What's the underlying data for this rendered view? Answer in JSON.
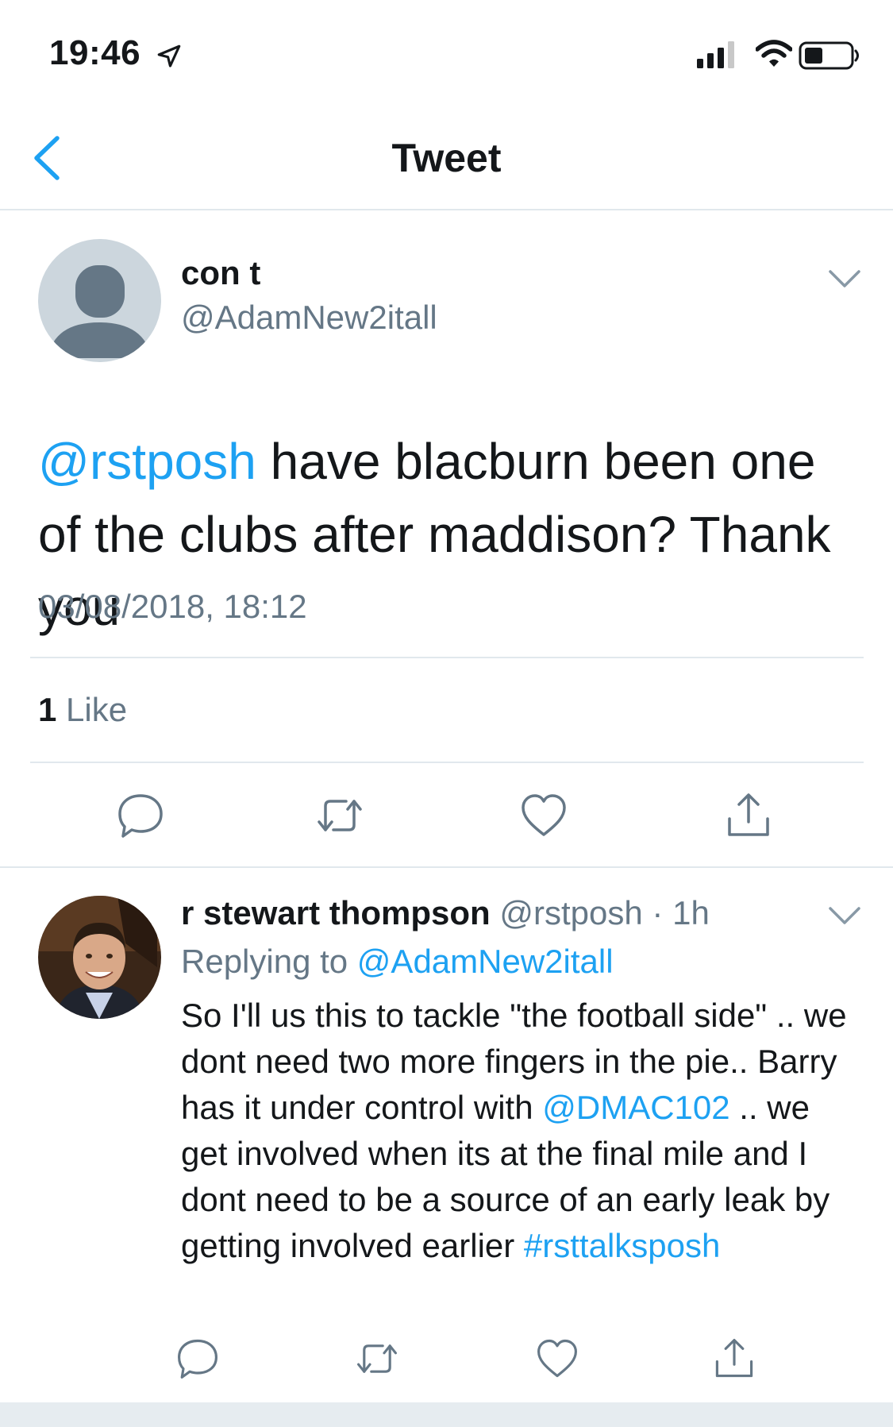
{
  "status_bar": {
    "time": "19:46",
    "icons": [
      "location-arrow-icon",
      "cellular-signal-icon",
      "wifi-icon",
      "battery-icon"
    ]
  },
  "nav": {
    "title": "Tweet",
    "back_icon": "chevron-left-icon"
  },
  "tweet": {
    "display_name": "con t",
    "handle": "@AdamNew2itall",
    "text_mention": "@rstposh",
    "text_body": " have blacburn been one of the clubs after maddison? Thank you",
    "timestamp": "03/08/2018, 18:12",
    "like_count": "1",
    "like_word": " Like",
    "actions": [
      "reply-icon",
      "retweet-icon",
      "like-icon",
      "share-icon"
    ]
  },
  "reply": {
    "display_name": "r stewart thompson",
    "handle": "@rstposh",
    "separator": " · ",
    "time_ago": "1h",
    "replying_prefix": "Replying to ",
    "replying_handle": "@AdamNew2itall",
    "text_part1": "So I'll us this to tackle \"the football side\" .. we dont need two more fingers in the pie.. Barry has it under control with ",
    "text_mention": "@DMAC102",
    "text_part2": " .. we get involved when its at the final mile and I dont need to be a source of an early leak by getting involved earlier ",
    "text_hashtag": "#rsttalksposh",
    "actions": [
      "reply-icon",
      "retweet-icon",
      "like-icon",
      "share-icon"
    ]
  },
  "colors": {
    "accent": "#1da1f2",
    "secondary_text": "#657786",
    "primary_text": "#14171a",
    "divider": "#e1e8ed"
  }
}
